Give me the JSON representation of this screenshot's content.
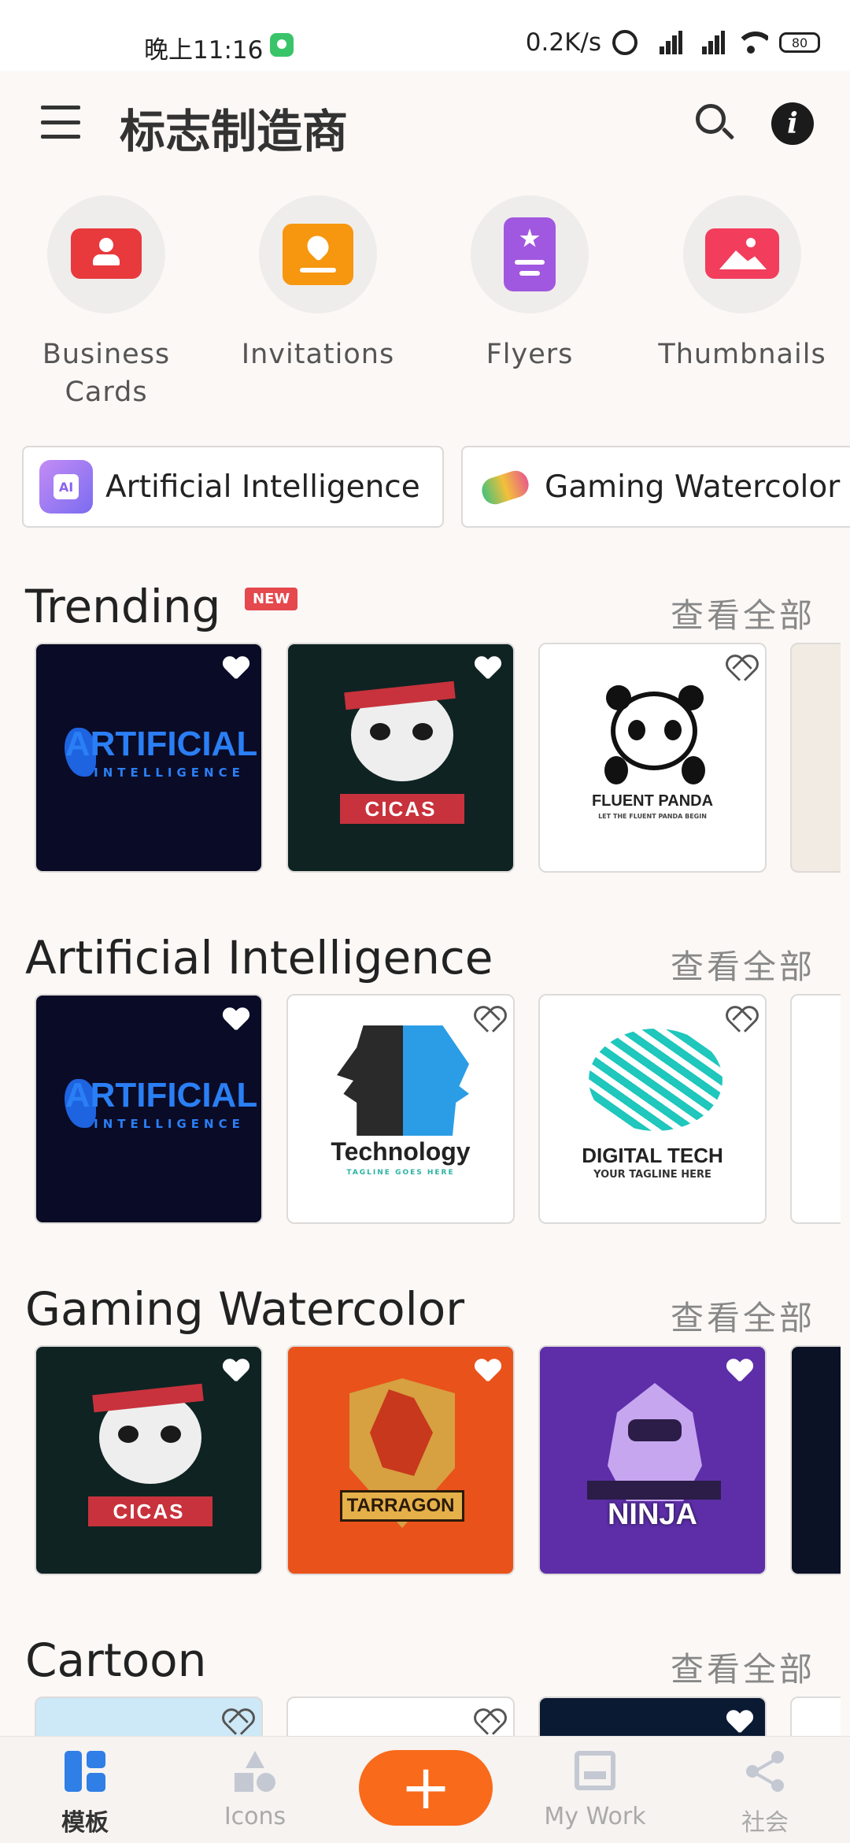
{
  "status_bar": {
    "time": "晚上11:16",
    "net_speed": "0.2K/s",
    "signal_1": "HD",
    "signal_2": "HD",
    "battery": "80"
  },
  "app_bar": {
    "title": "标志制造商"
  },
  "quick_categories": [
    {
      "label": "Business Cards",
      "icon": "id-card-icon",
      "color": "#e8393d"
    },
    {
      "label": "Invitations",
      "icon": "invitation-icon",
      "color": "#f7960f"
    },
    {
      "label": "Flyers",
      "icon": "flyer-icon",
      "color": "#a158e0"
    },
    {
      "label": "Thumbnails",
      "icon": "image-icon",
      "color": "#f23d5c"
    }
  ],
  "chips": [
    {
      "label": "Artificial Intelligence",
      "icon": "ai-chip-icon"
    },
    {
      "label": "Gaming Watercolor",
      "icon": "gamepad-icon"
    }
  ],
  "sections": [
    {
      "title": "Trending",
      "badge": "NEW",
      "see_all": "查看全部",
      "cards": [
        {
          "name": "ARTIFICIAL",
          "sub": "INTELLIGENCE",
          "bg": "#0a0b26",
          "fg": "#2a7ff5"
        },
        {
          "name": "CICAS",
          "sub": "",
          "bg": "#0f2323",
          "fg": "#ffffff"
        },
        {
          "name": "FLUENT PANDA",
          "sub": "LET THE FLUENT PANDA BEGIN",
          "bg": "#ffffff",
          "fg": "#222222"
        }
      ]
    },
    {
      "title": "Artificial Intelligence",
      "badge": "",
      "see_all": "查看全部",
      "cards": [
        {
          "name": "ARTIFICIAL",
          "sub": "INTELLIGENCE",
          "bg": "#0a0b26",
          "fg": "#2a7ff5"
        },
        {
          "name": "Technology",
          "sub": "TAGLINE GOES HERE",
          "bg": "#ffffff",
          "fg": "#222222"
        },
        {
          "name": "DIGITAL TECH",
          "sub": "YOUR TAGLINE HERE",
          "bg": "#ffffff",
          "fg": "#222222"
        }
      ]
    },
    {
      "title": "Gaming Watercolor",
      "badge": "",
      "see_all": "查看全部",
      "cards": [
        {
          "name": "CICAS",
          "sub": "",
          "bg": "#0f2323",
          "fg": "#ffffff"
        },
        {
          "name": "TARRAGON",
          "sub": "",
          "bg": "#e9521a",
          "fg": "#2b1a0a"
        },
        {
          "name": "NINJA",
          "sub": "",
          "bg": "#5d2ea8",
          "fg": "#ffffff"
        }
      ]
    },
    {
      "title": "Cartoon",
      "badge": "",
      "see_all": "查看全部",
      "cards": []
    }
  ],
  "bottom_nav": {
    "items": [
      {
        "label": "模板",
        "icon": "templates-icon",
        "active": true
      },
      {
        "label": "Icons",
        "icon": "shapes-icon",
        "active": false
      },
      {
        "label": "My Work",
        "icon": "inbox-icon",
        "active": false
      },
      {
        "label": "社会",
        "icon": "share-icon",
        "active": false
      }
    ],
    "fab_label": "+"
  }
}
